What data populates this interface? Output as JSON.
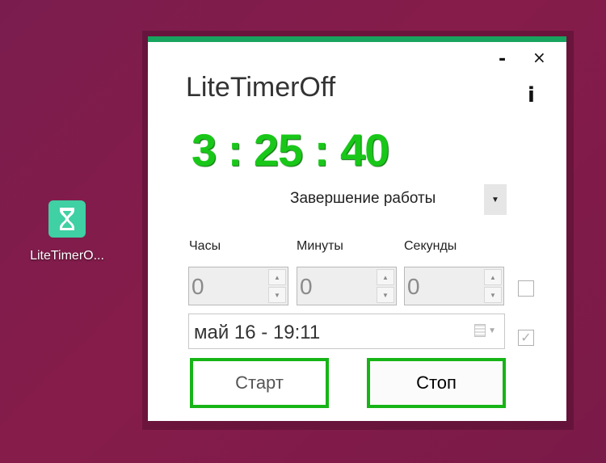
{
  "desktop": {
    "icon_label": "LiteTimerO...",
    "icon_color": "#3fd0a3"
  },
  "window": {
    "accent_color": "#18a45e",
    "minimize_label": "-",
    "close_label": "×",
    "info_label": "i",
    "title": "LiteTimerOff",
    "countdown": "3 : 25 : 40",
    "countdown_color": "#19c719",
    "action": {
      "selected": "Завершение работы",
      "dropdown_icon": "▼"
    },
    "fields": {
      "hours_label": "Часы",
      "minutes_label": "Минуты",
      "seconds_label": "Секунды",
      "hours_value": "0",
      "minutes_value": "0",
      "seconds_value": "0"
    },
    "time_checkbox_checked": false,
    "date_value": "май  16 - 19:11",
    "date_checkbox_checked": true,
    "buttons": {
      "start": "Старт",
      "stop": "Стоп",
      "border_color": "#17b417"
    }
  }
}
